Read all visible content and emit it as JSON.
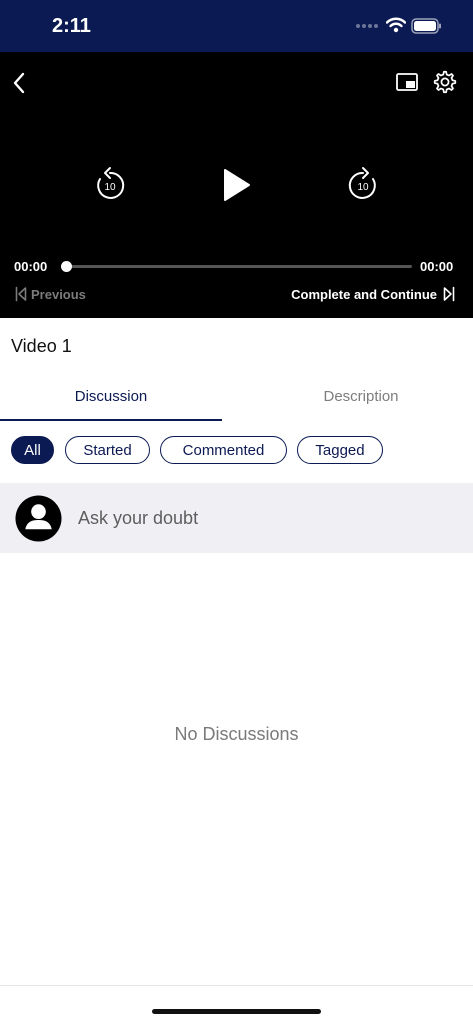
{
  "status_bar": {
    "time": "2:11"
  },
  "player": {
    "current_time": "00:00",
    "total_time": "00:00",
    "progress": 0,
    "rewind_seconds": "10",
    "forward_seconds": "10",
    "previous_label": "Previous",
    "next_label": "Complete and Continue",
    "icons": [
      "back-icon",
      "pip-icon",
      "gear-icon",
      "rewind-10-icon",
      "play-icon",
      "forward-10-icon",
      "skip-previous-icon",
      "skip-next-icon"
    ]
  },
  "content": {
    "title": "Video 1",
    "tabs": [
      {
        "label": "Discussion",
        "active": true
      },
      {
        "label": "Description",
        "active": false
      }
    ],
    "filters": [
      {
        "label": "All",
        "active": true
      },
      {
        "label": "Started",
        "active": false
      },
      {
        "label": "Commented",
        "active": false
      },
      {
        "label": "Tagged",
        "active": false
      }
    ],
    "ask_placeholder": "Ask your doubt",
    "empty_message": "No Discussions"
  },
  "colors": {
    "brand_navy": "#0b1a52",
    "player_bg": "#000000",
    "ask_bar_bg": "#f0f0f4",
    "muted_text": "#7a7a7a"
  }
}
